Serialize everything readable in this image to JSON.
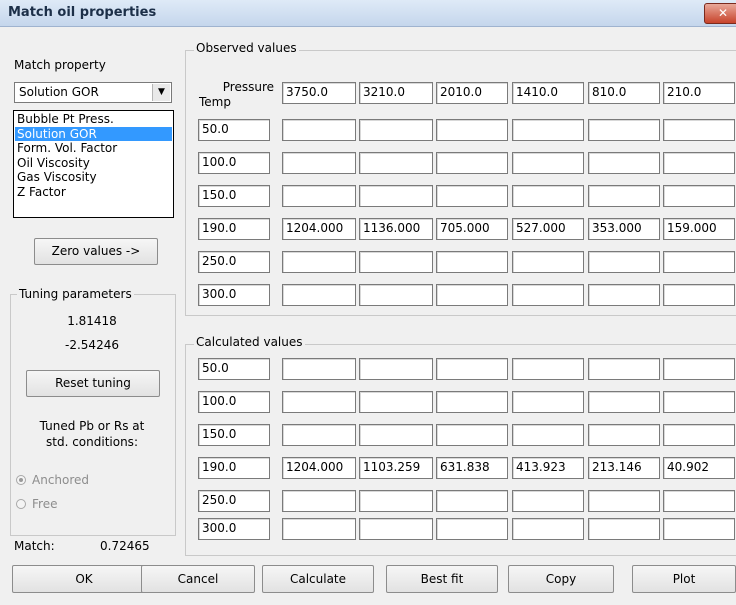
{
  "window": {
    "title": "Match oil properties",
    "close_icon": "close-icon"
  },
  "left_panel": {
    "match_property_label": "Match property",
    "combo_selected": "Solution GOR",
    "dropdown_options": [
      "Bubble Pt Press.",
      "Solution GOR",
      "Form. Vol. Factor",
      "Oil Viscosity",
      "Gas Viscosity",
      "Z Factor"
    ],
    "dropdown_selected_index": 1,
    "zero_values_button": "Zero values ->",
    "tuning": {
      "caption": "Tuning parameters",
      "param1": "1.81418",
      "param2": "-2.54246",
      "reset_button": "Reset tuning",
      "tuned_label_line1": "Tuned Pb or Rs at",
      "tuned_label_line2": "std. conditions:",
      "radio_anchored": "Anchored",
      "radio_free": "Free",
      "selected_radio": "Anchored"
    },
    "match_label": "Match:",
    "match_value": "0.72465"
  },
  "observed": {
    "caption": "Observed values",
    "pressure_label": "Pressure",
    "temp_label": "Temp",
    "pressures": [
      "3750.0",
      "3210.0",
      "2010.0",
      "1410.0",
      "810.0",
      "210.0"
    ],
    "temps": [
      "50.0",
      "100.0",
      "150.0",
      "190.0",
      "250.0",
      "300.0"
    ],
    "rows": [
      [
        "",
        "",
        "",
        "",
        "",
        ""
      ],
      [
        "",
        "",
        "",
        "",
        "",
        ""
      ],
      [
        "",
        "",
        "",
        "",
        "",
        ""
      ],
      [
        "1204.000",
        "1136.000",
        "705.000",
        "527.000",
        "353.000",
        "159.000"
      ],
      [
        "",
        "",
        "",
        "",
        "",
        ""
      ],
      [
        "",
        "",
        "",
        "",
        "",
        ""
      ]
    ]
  },
  "calculated": {
    "caption": "Calculated values",
    "temps": [
      "50.0",
      "100.0",
      "150.0",
      "190.0",
      "250.0",
      "300.0"
    ],
    "rows": [
      [
        "",
        "",
        "",
        "",
        "",
        ""
      ],
      [
        "",
        "",
        "",
        "",
        "",
        ""
      ],
      [
        "",
        "",
        "",
        "",
        "",
        ""
      ],
      [
        "1204.000",
        "1103.259",
        "631.838",
        "413.923",
        "213.146",
        "40.902"
      ],
      [
        "",
        "",
        "",
        "",
        "",
        ""
      ],
      [
        "",
        "",
        "",
        "",
        "",
        ""
      ]
    ]
  },
  "buttons": {
    "ok": "OK",
    "cancel": "Cancel",
    "calculate": "Calculate",
    "best_fit": "Best fit",
    "copy": "Copy",
    "plot": "Plot"
  }
}
